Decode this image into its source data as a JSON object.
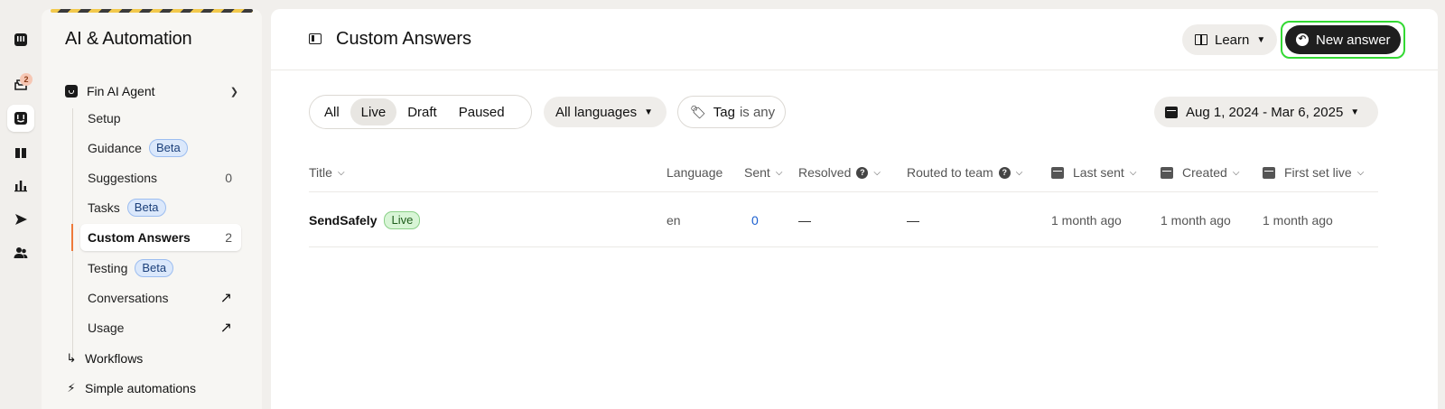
{
  "rail": {
    "items": [
      {
        "name": "inbox-icon"
      },
      {
        "name": "messages-icon",
        "badge": "2"
      },
      {
        "name": "fin-icon",
        "active": true
      },
      {
        "name": "knowledge-icon"
      },
      {
        "name": "reports-icon"
      },
      {
        "name": "outbound-icon"
      },
      {
        "name": "contacts-icon"
      }
    ]
  },
  "sidebar": {
    "title": "AI & Automation",
    "group": {
      "label": "Fin AI Agent"
    },
    "items": [
      {
        "label": "Setup"
      },
      {
        "label": "Guidance",
        "badge": "Beta"
      },
      {
        "label": "Suggestions",
        "count": "0"
      },
      {
        "label": "Tasks",
        "badge": "Beta"
      },
      {
        "label": "Custom Answers",
        "count": "2",
        "active": true
      },
      {
        "label": "Testing",
        "badge": "Beta"
      },
      {
        "label": "Conversations",
        "external": true
      },
      {
        "label": "Usage",
        "external": true
      }
    ],
    "roots": [
      {
        "label": "Workflows",
        "icon": "workflows-icon"
      },
      {
        "label": "Simple automations",
        "icon": "bolt-icon"
      }
    ]
  },
  "header": {
    "title": "Custom Answers",
    "learn_label": "Learn",
    "new_answer_label": "New answer"
  },
  "filters": {
    "status": [
      {
        "label": "All"
      },
      {
        "label": "Live",
        "selected": true
      },
      {
        "label": "Draft"
      },
      {
        "label": "Paused"
      }
    ],
    "language": "All languages",
    "tag_label": "Tag",
    "tag_value": "is any",
    "date_range": "Aug 1, 2024 - Mar 6, 2025"
  },
  "table": {
    "columns": {
      "title": "Title",
      "language": "Language",
      "sent": "Sent",
      "resolved": "Resolved",
      "routed": "Routed to team",
      "last_sent": "Last sent",
      "created": "Created",
      "first_live": "First set live"
    },
    "rows": [
      {
        "title": "SendSafely",
        "status": "Live",
        "language": "en",
        "sent": "0",
        "resolved": "—",
        "routed": "—",
        "last_sent": "1 month ago",
        "created": "1 month ago",
        "first_live": "1 month ago"
      }
    ]
  },
  "colors": {
    "accent_active_bar": "#ee7a3b",
    "focus_ring": "#33d933",
    "link": "#1a5fd0"
  }
}
